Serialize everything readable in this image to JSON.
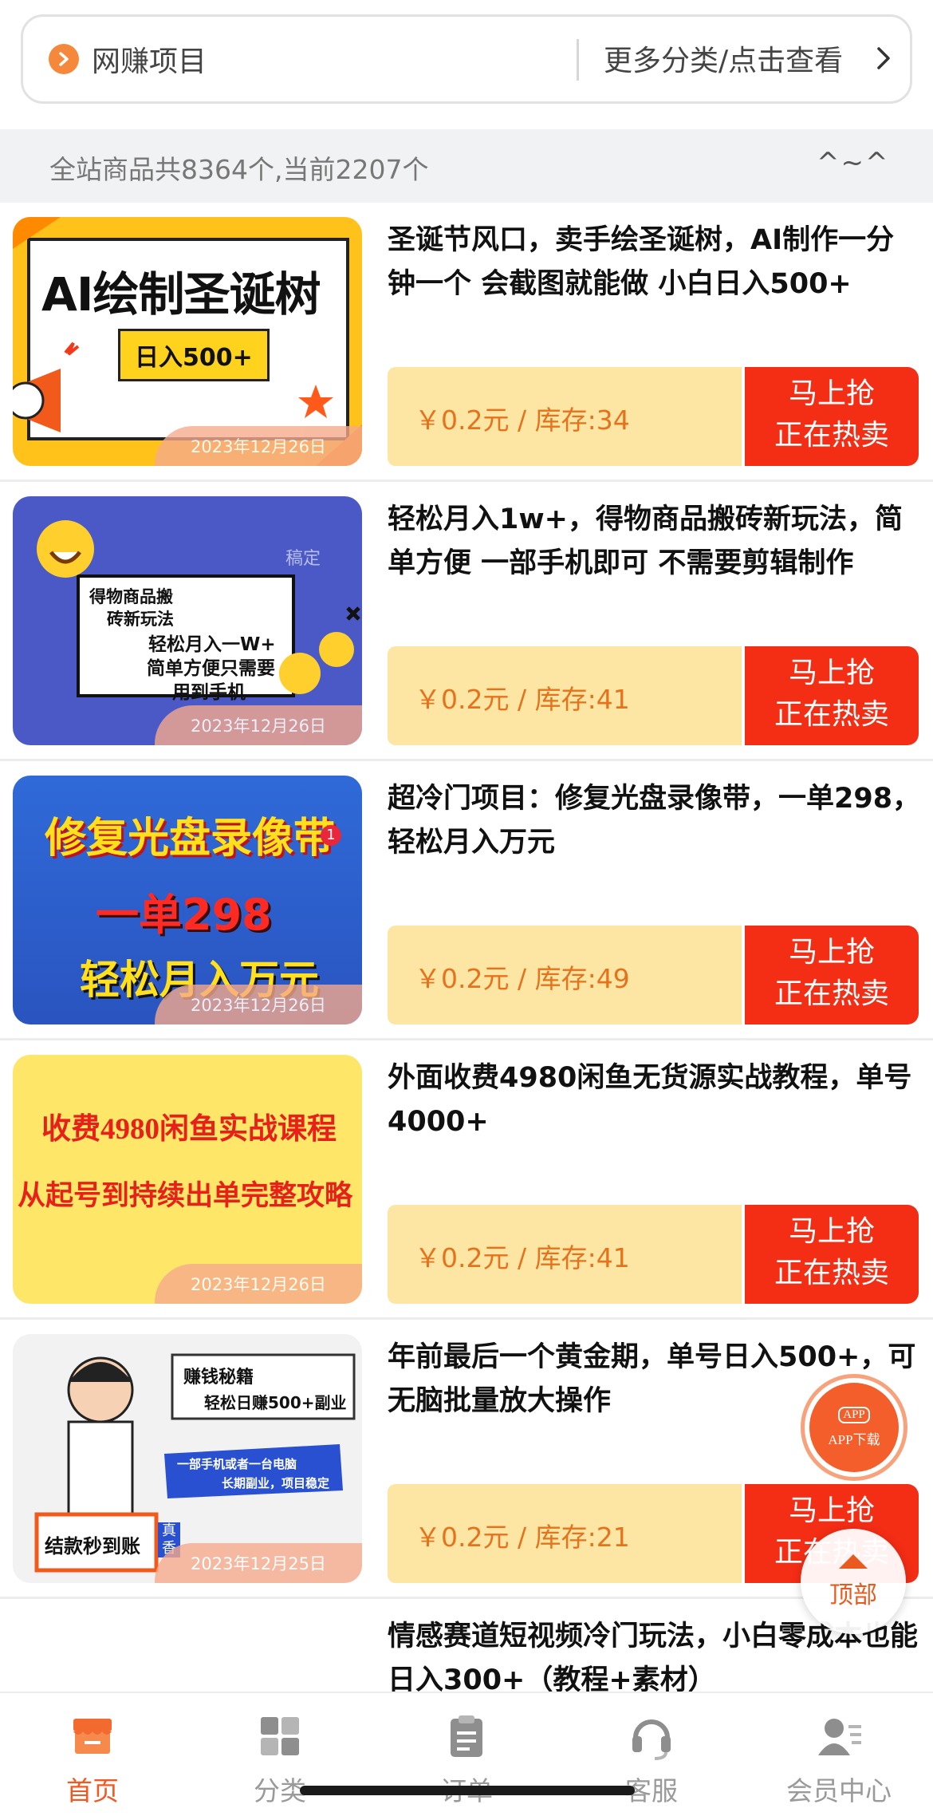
{
  "category_bar": {
    "title": "网赚项目",
    "more_label": "更多分类/点击查看"
  },
  "count_bar": {
    "text": "全站商品共8364个,当前2207个",
    "face": "^~^"
  },
  "products": [
    {
      "title": "圣诞节风口，卖手绘圣诞树，AI制作一分钟一个 会截图就能做 小白日入500+",
      "price": "￥0.2元 / 库存:34",
      "buy_line1": "马上抢",
      "buy_line2": "正在热卖",
      "date": "2023年12月26日",
      "thumb": {
        "line1": "AI绘制圣诞树",
        "line2": "日入500+"
      }
    },
    {
      "title": "轻松月入1w+，得物商品搬砖新玩法，简单方便 一部手机即可 不需要剪辑制作",
      "price": "￥0.2元 / 库存:41",
      "buy_line1": "马上抢",
      "buy_line2": "正在热卖",
      "date": "2023年12月26日",
      "thumb": {
        "line1": "得物商品搬",
        "line2": "砖新玩法",
        "line3": "轻松月入一W+",
        "line4": "简单方便只需要",
        "line5": "用到手机",
        "mark": "稿定"
      }
    },
    {
      "title": "超冷门项目：修复光盘录像带，一单298，轻松月入万元",
      "price": "￥0.2元 / 库存:49",
      "buy_line1": "马上抢",
      "buy_line2": "正在热卖",
      "date": "2023年12月26日",
      "thumb": {
        "line1": "修复光盘录像带",
        "line2": "一单298",
        "line3": "轻松月入万元",
        "badge": "1"
      }
    },
    {
      "title": "外面收费4980闲鱼无货源实战教程，单号4000+",
      "price": "￥0.2元 / 库存:41",
      "buy_line1": "马上抢",
      "buy_line2": "正在热卖",
      "date": "2023年12月26日",
      "thumb": {
        "line1": "收费4980闲鱼实战课程",
        "line2": "从起号到持续出单完整攻略"
      }
    },
    {
      "title": "年前最后一个黄金期，单号日入500+，可无脑批量放大操作",
      "price": "￥0.2元 / 库存:21",
      "buy_line1": "马上抢",
      "buy_line2": "正在热卖",
      "date": "2023年12月25日",
      "thumb": {
        "line1": "赚钱秘籍",
        "line2": "轻松日赚500+副业",
        "line3": "一部手机或者一台电脑",
        "line4": "长期副业，项目稳定",
        "line5": "结款秒到账",
        "tag": "真香"
      }
    },
    {
      "title": "情感赛道短视频冷门玩法，小白零成本也能日入300+（教程+素材）"
    }
  ],
  "floating": {
    "app_badge": "APP",
    "app_label": "APP下载",
    "top_label": "顶部"
  },
  "tabs": [
    {
      "label": "首页",
      "icon": "store-icon",
      "active": true
    },
    {
      "label": "分类",
      "icon": "grid-icon",
      "active": false
    },
    {
      "label": "订单",
      "icon": "clipboard-icon",
      "active": false
    },
    {
      "label": "客服",
      "icon": "headset-icon",
      "active": false
    },
    {
      "label": "会员中心",
      "icon": "user-icon",
      "active": false
    }
  ],
  "colors": {
    "accent": "#f05a22",
    "buy_button": "#f42d15",
    "price_bg": "#fde5a4",
    "price_text": "#e5731d"
  }
}
